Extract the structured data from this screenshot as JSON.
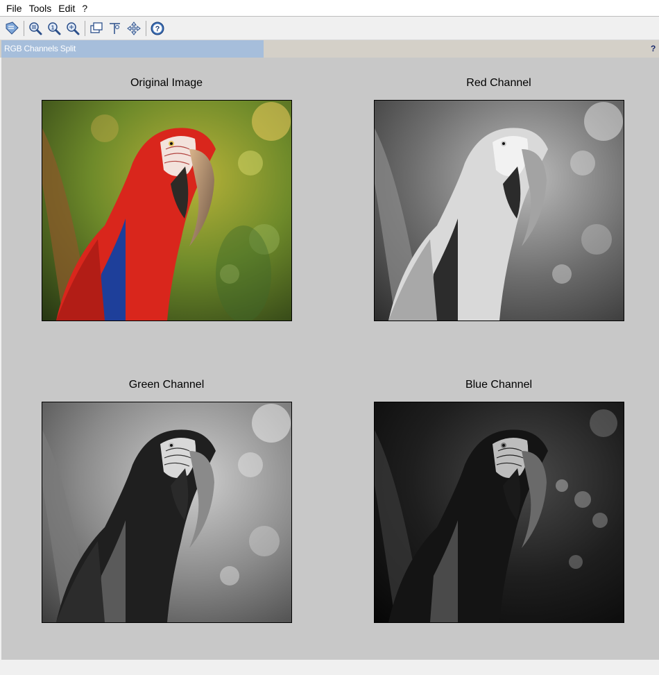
{
  "menu": [
    "File",
    "Tools",
    "Edit",
    "?"
  ],
  "toolbar": {
    "icons": [
      "select-arrow-icon",
      "zoom-region-icon",
      "zoom-in-icon",
      "zoom-out-icon",
      "window-icon",
      "data-cursor-icon",
      "pan-icon",
      "help-icon"
    ]
  },
  "window": {
    "title": "RGB Channels Split",
    "help": "?"
  },
  "panels": [
    {
      "title": "Original Image",
      "channel": "original"
    },
    {
      "title": "Red Channel",
      "channel": "red"
    },
    {
      "title": "Green Channel",
      "channel": "green"
    },
    {
      "title": "Blue Channel",
      "channel": "blue"
    }
  ],
  "colors": {
    "title_fill": "#a6bedb",
    "figure_bg": "#c8c8c8",
    "macaw_red": "#d9261c",
    "foliage_green": "#6e8a2a"
  }
}
